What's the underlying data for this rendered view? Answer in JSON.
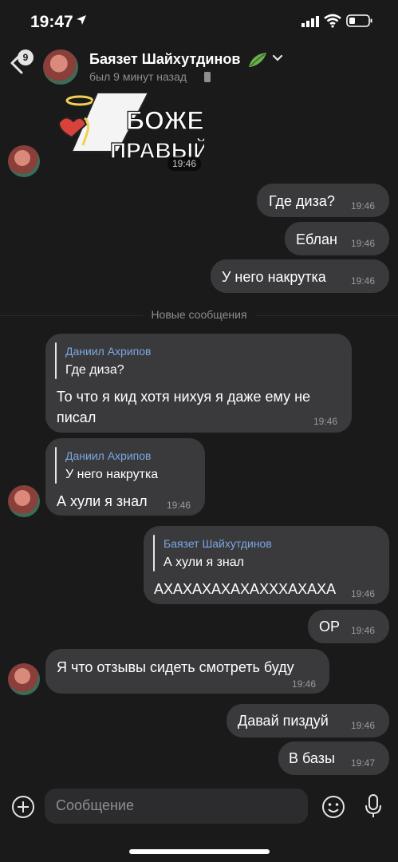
{
  "status_bar": {
    "time": "19:47"
  },
  "header": {
    "unread_count": "9",
    "contact_name": "Баязет Шайхутдинов",
    "last_seen": "был 9 минут назад"
  },
  "messages": [
    {
      "type": "sticker",
      "text_line1": "БОЖЕ",
      "text_line2": "ПРАВЫЙ",
      "time": "19:46"
    },
    {
      "type": "out",
      "text": "Где диза?",
      "time": "19:46"
    },
    {
      "type": "out",
      "text": "Еблан",
      "time": "19:46"
    },
    {
      "type": "out",
      "text": "У него накрутка",
      "time": "19:46"
    },
    {
      "type": "divider",
      "text": "Новые сообщения"
    },
    {
      "type": "in",
      "reply_name": "Даниил Ахрипов",
      "reply_text": "Где диза?",
      "text_line1": "То что я кид хотя нихуя я даже ему не",
      "text_line2": "писал",
      "time": "19:46"
    },
    {
      "type": "in",
      "reply_name": "Даниил Ахрипов",
      "reply_text": "У него накрутка",
      "text": "А хули я знал",
      "time": "19:46"
    },
    {
      "type": "out",
      "reply_name": "Баязет Шайхутдинов",
      "reply_text": "А хули я знал",
      "text": "АХАХАХАХАХАХХХАХАХА",
      "time": "19:46"
    },
    {
      "type": "out",
      "text": "ОР",
      "time": "19:46"
    },
    {
      "type": "in",
      "text": "Я что отзывы сидеть смотреть буду",
      "time": "19:46"
    },
    {
      "type": "out",
      "text": "Давай пиздуй",
      "time": "19:46"
    },
    {
      "type": "out",
      "text": "В базы",
      "time": "19:47"
    }
  ],
  "input": {
    "placeholder": "Сообщение"
  },
  "icons": {
    "back": "chevron-left-icon",
    "add": "plus-circle-icon",
    "emoji": "smile-icon",
    "mic": "microphone-icon"
  },
  "colors": {
    "background": "#1a1a1b",
    "bubble": "#3a3a3c",
    "reply_name": "#7ba8e2"
  }
}
